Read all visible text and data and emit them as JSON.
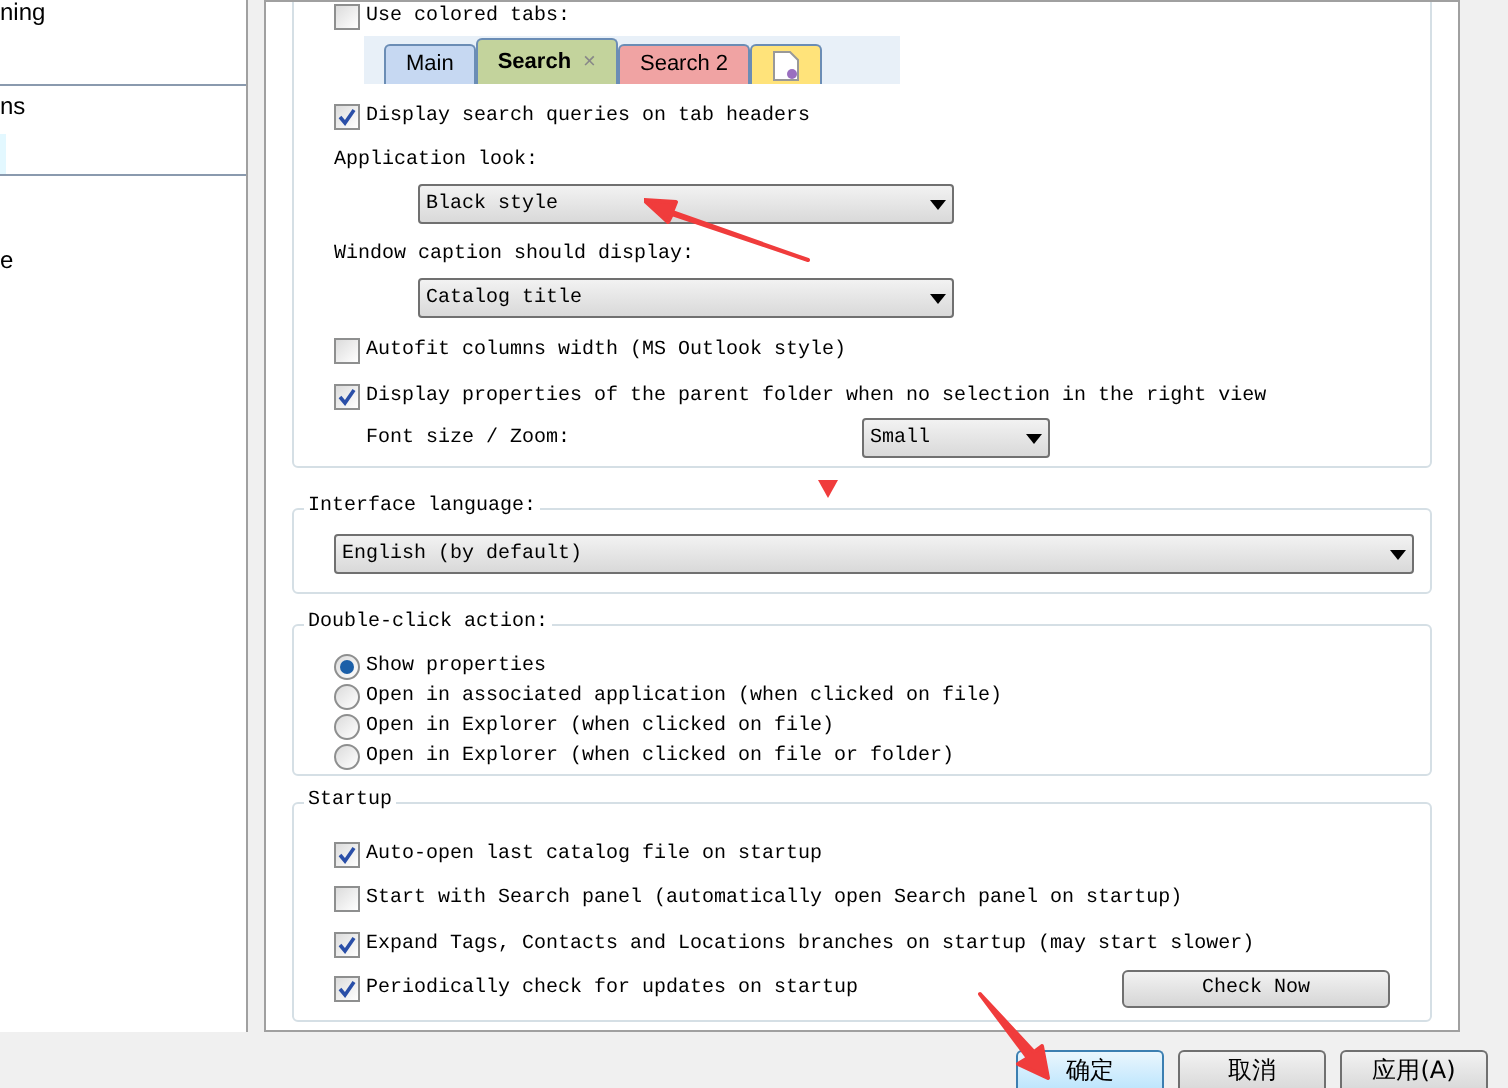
{
  "sidebar": {
    "items": [
      {
        "label": "ning",
        "selected": false
      },
      {
        "label": "ns",
        "selected": false
      },
      {
        "selected": true
      },
      {
        "label": "e",
        "selected": false
      }
    ]
  },
  "appearance": {
    "colored_tabs": {
      "label": "Use colored tabs:",
      "checked": false
    },
    "tab_preview": [
      {
        "kind": "text",
        "label": "Main",
        "selected": false,
        "color": "#c6d8f2"
      },
      {
        "kind": "text",
        "label": "Search",
        "selected": true,
        "close": "×",
        "color": "#c3d39c"
      },
      {
        "kind": "text",
        "label": "Search 2",
        "selected": false,
        "color": "#f0a3a3"
      },
      {
        "kind": "icon",
        "selected": false,
        "color": "#ffe37a"
      }
    ],
    "options": [
      {
        "kind": "check",
        "label": "Display search queries on tab headers",
        "checked": true
      },
      {
        "kind": "select",
        "label": "Application look:",
        "value": "Black style"
      },
      {
        "kind": "select",
        "label": "Window caption should display:",
        "value": "Catalog title"
      },
      {
        "kind": "check",
        "label": "Autofit columns width (MS Outlook style)",
        "checked": false
      },
      {
        "kind": "check",
        "label": "Display properties of the parent folder when no selection in the right view",
        "checked": true
      },
      {
        "kind": "inline_select",
        "label": "Font size / Zoom:",
        "value": "Small"
      }
    ]
  },
  "interface_language": {
    "title": "Interface language:",
    "value": "English (by default)"
  },
  "double_click": {
    "title": "Double-click action:",
    "options": [
      {
        "label": "Show properties",
        "selected": true
      },
      {
        "label": "Open in associated application (when clicked on file)",
        "selected": false
      },
      {
        "label": "Open in Explorer (when clicked on file)",
        "selected": false
      },
      {
        "label": "Open in Explorer (when clicked on file or folder)",
        "selected": false
      }
    ]
  },
  "startup": {
    "title": "Startup",
    "options": [
      {
        "label": "Auto-open last catalog file on startup",
        "checked": true
      },
      {
        "label": "Start with Search panel (automatically open Search panel on startup)",
        "checked": false
      },
      {
        "label": "Expand Tags, Contacts and Locations branches on startup (may start slower)",
        "checked": true
      },
      {
        "label": "Periodically check for updates on startup",
        "checked": true
      }
    ],
    "button": "Check Now"
  },
  "buttons": [
    {
      "label": "确定",
      "selected": true
    },
    {
      "label": "取消",
      "selected": false
    },
    {
      "label": "应用(A)",
      "selected": false
    }
  ]
}
